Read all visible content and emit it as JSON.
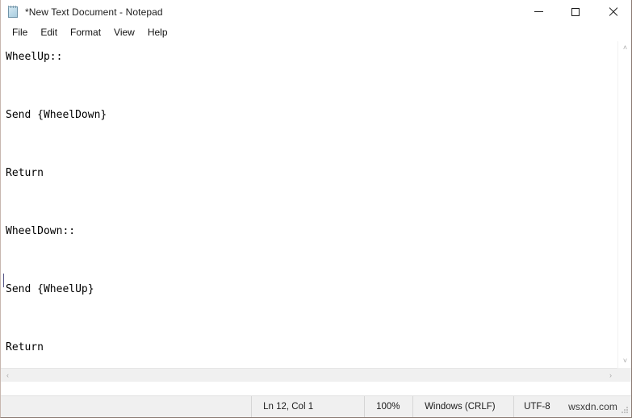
{
  "window": {
    "title": "*New Text Document - Notepad",
    "icon": "notepad-icon",
    "controls": {
      "minimize": "Minimize",
      "maximize": "Maximize",
      "close": "Close"
    }
  },
  "menubar": {
    "items": [
      {
        "label": "File"
      },
      {
        "label": "Edit"
      },
      {
        "label": "Format"
      },
      {
        "label": "View"
      },
      {
        "label": "Help"
      }
    ]
  },
  "editor": {
    "content": "WheelUp::\n\nSend {WheelDown}\n\nReturn\n\nWheelDown::\n\nSend {WheelUp}\n\nReturn\n",
    "lines": [
      "WheelUp::",
      "",
      "Send {WheelDown}",
      "",
      "Return",
      "",
      "WheelDown::",
      "",
      "Send {WheelUp}",
      "",
      "Return",
      ""
    ]
  },
  "scrollbars": {
    "vertical": {
      "up_arrow": "˄",
      "down_arrow": "˅"
    },
    "horizontal": {
      "left_arrow": "‹",
      "right_arrow": "›"
    }
  },
  "statusbar": {
    "position": "Ln 12, Col 1",
    "zoom": "100%",
    "line_ending": "Windows (CRLF)",
    "encoding": "UTF-8",
    "watermark": "wsxdn.com"
  },
  "colors": {
    "window_bg": "#ffffff",
    "statusbar_bg": "#f0f0f0",
    "text": "#000000",
    "border": "#8a7a72"
  }
}
